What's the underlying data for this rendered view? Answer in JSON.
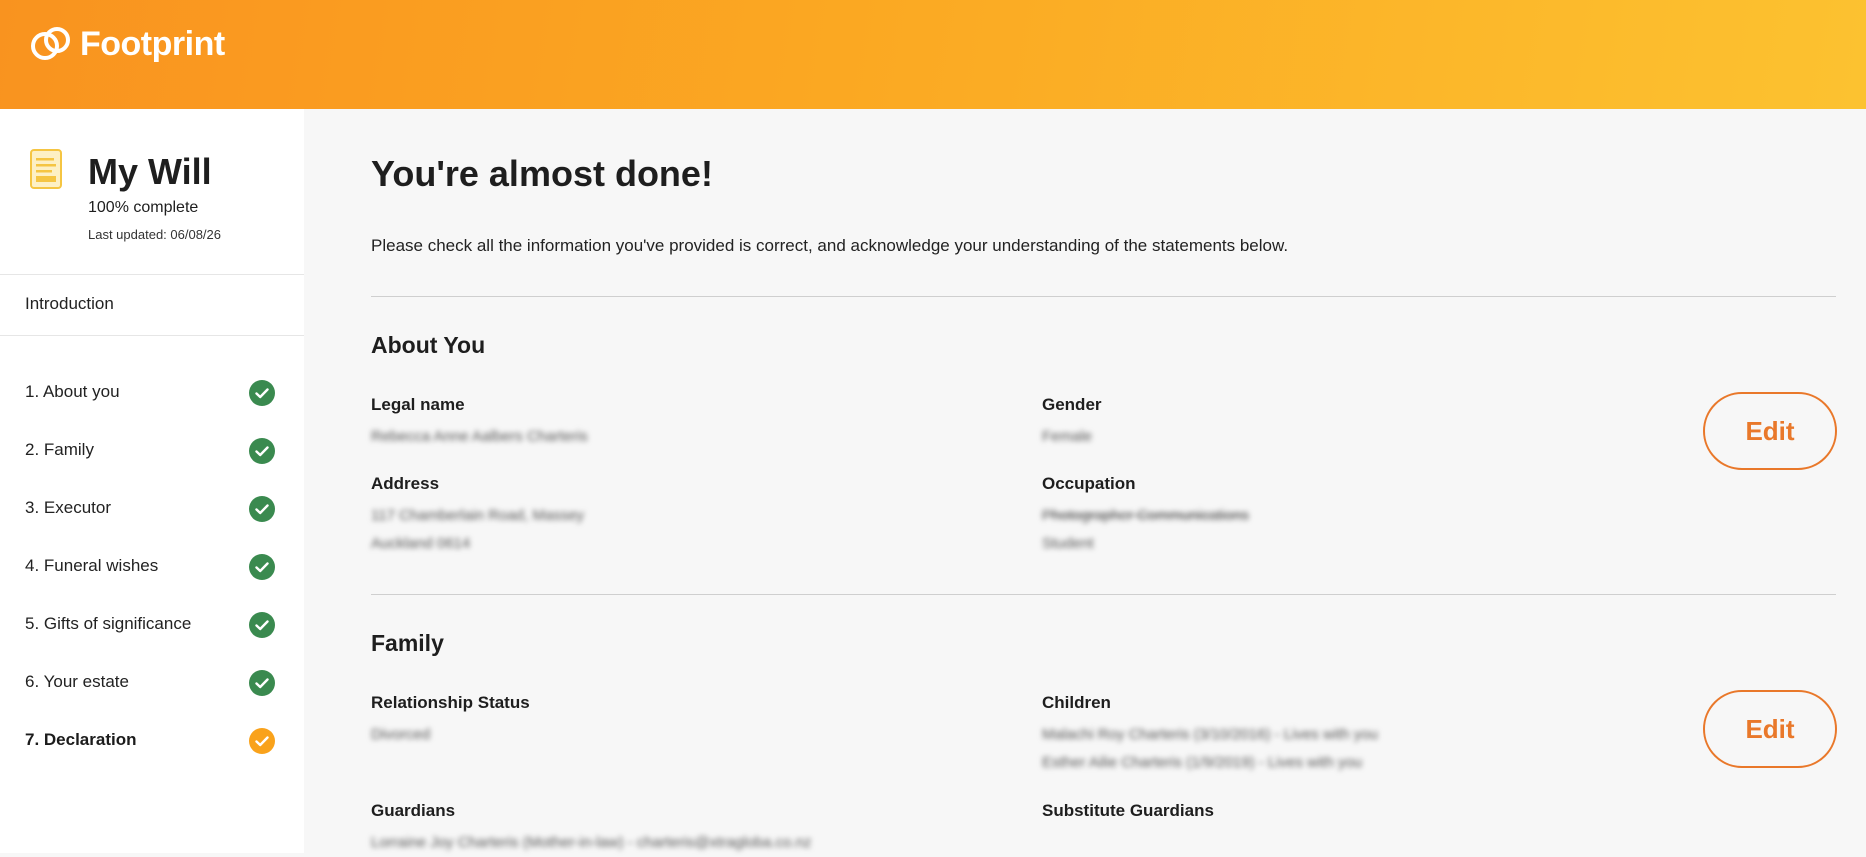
{
  "brand": {
    "name": "Footprint"
  },
  "sidebar": {
    "will_title": "My Will",
    "complete": "100% complete",
    "last_updated": "Last updated: 06/08/26",
    "intro": "Introduction",
    "items": [
      {
        "label": "1. About you",
        "status": "done"
      },
      {
        "label": "2. Family",
        "status": "done"
      },
      {
        "label": "3. Executor",
        "status": "done"
      },
      {
        "label": "4. Funeral wishes",
        "status": "done"
      },
      {
        "label": "5. Gifts of significance",
        "status": "done"
      },
      {
        "label": "6. Your estate",
        "status": "done"
      },
      {
        "label": "7. Declaration",
        "status": "current"
      }
    ]
  },
  "main": {
    "title": "You're almost done!",
    "subtitle": "Please check all the information you've provided is correct, and acknowledge your understanding of the statements below.",
    "about": {
      "title": "About You",
      "legal_name_label": "Legal name",
      "legal_name_value": "Rebecca Anne Aalbers Charteris",
      "gender_label": "Gender",
      "gender_value": "Female",
      "address_label": "Address",
      "address_line1": "117 Chamberlain Road, Massey",
      "address_line2": "Auckland 0614",
      "occupation_label": "Occupation",
      "occupation_line1": "Photographer Communications",
      "occupation_line2": "Student",
      "edit_label": "Edit"
    },
    "family": {
      "title": "Family",
      "relationship_label": "Relationship Status",
      "relationship_value": "Divorced",
      "children_label": "Children",
      "children_line1": "Malachi Roy Charteris (3/10/2016) - Lives with you",
      "children_line2": "Esther Ailie Charteris (1/9/2019) - Lives with you",
      "guardians_label": "Guardians",
      "guardians_value": "Lorraine Joy Charteris (Mother-in-law) - charteris@xtragloba.co.nz",
      "substitute_label": "Substitute Guardians",
      "edit_label": "Edit"
    }
  },
  "colors": {
    "header_start": "#f9931f",
    "header_end": "#fcc230",
    "accent": "#e9782a",
    "done": "#3a8a4f",
    "current": "#f9a21b"
  }
}
